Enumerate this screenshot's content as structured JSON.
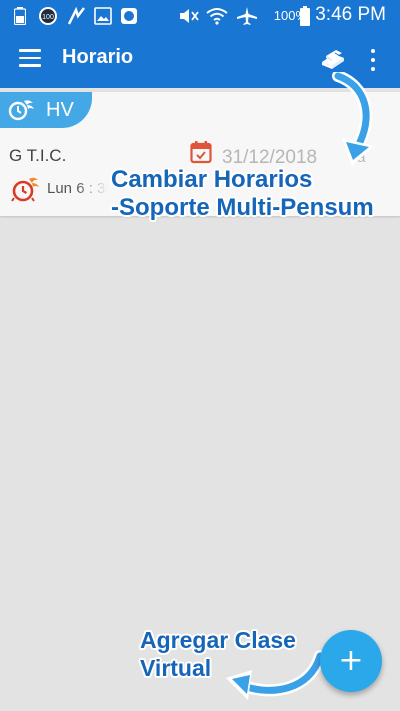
{
  "status_bar": {
    "battery_percent": "100%",
    "time": "3:46 PM",
    "left_icons": [
      "battery-small-icon",
      "badge-100-icon",
      "app-k-icon",
      "image-icon",
      "circle-app-icon"
    ],
    "right_icons": [
      "mute-icon",
      "wifi-icon",
      "airplane-icon",
      "battery-icon"
    ]
  },
  "app_bar": {
    "title": "Horario",
    "color": "#1976d2"
  },
  "card": {
    "badge_label": "HV",
    "course_name": "G T.I.C.",
    "date_text": "31/12/2018",
    "date_suffix": "ta",
    "schedule_text": "Lun 6 : 30"
  },
  "annotations": {
    "cambiar_line1": "Cambiar Horarios",
    "cambiar_line2": "-Soporte Multi-Pensum",
    "agregar_line1": "Agregar Clase",
    "agregar_line2": "Virtual"
  },
  "fab": {
    "symbol": "+",
    "color": "#2aa8ea"
  }
}
